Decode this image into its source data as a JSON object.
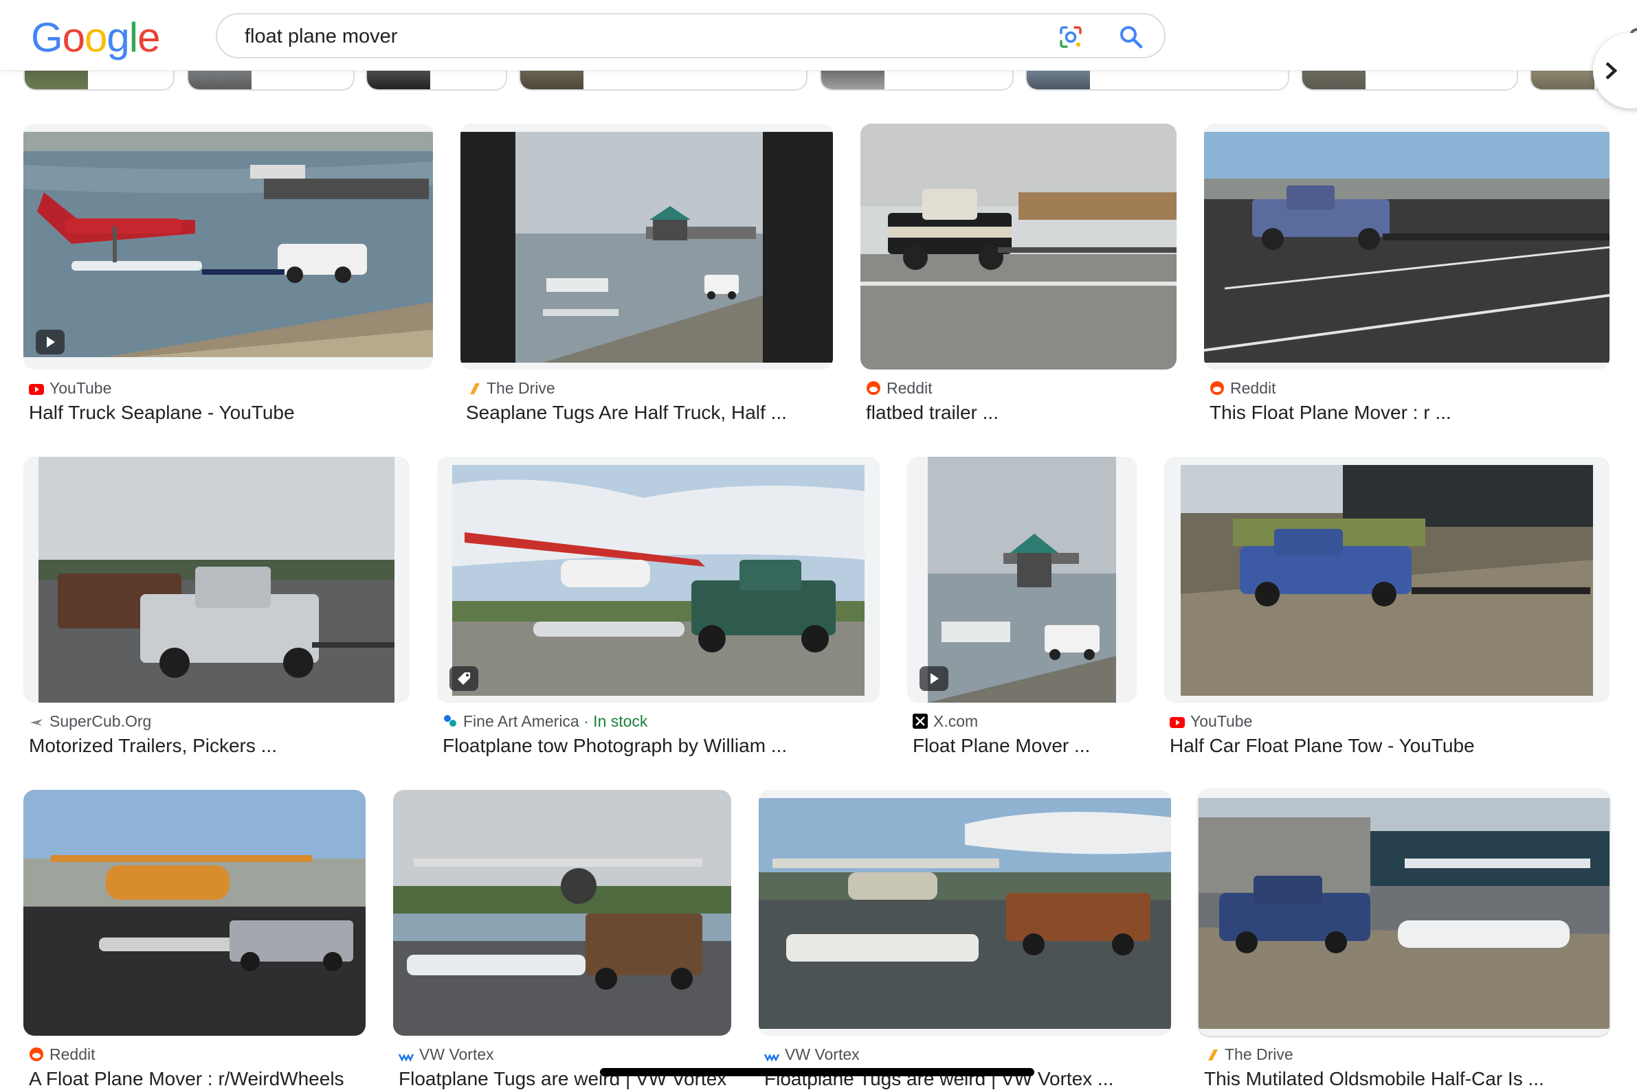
{
  "header": {
    "logo_letters": [
      {
        "ch": "G",
        "color": "#4285F4"
      },
      {
        "ch": "o",
        "color": "#EA4335"
      },
      {
        "ch": "o",
        "color": "#FBBC05"
      },
      {
        "ch": "g",
        "color": "#4285F4"
      },
      {
        "ch": "l",
        "color": "#34A853"
      },
      {
        "ch": "e",
        "color": "#EA4335"
      }
    ],
    "search_value": "float plane mover"
  },
  "icons": {
    "lens": "google-lens-icon",
    "search": "search-icon",
    "next": "chevron-right-icon",
    "play": "play-icon",
    "tag": "price-tag-icon"
  },
  "results": [
    {
      "source": "YouTube",
      "title": "Half Truck Seaplane - YouTube",
      "badge": "play",
      "favicon": "youtube"
    },
    {
      "source": "The Drive",
      "title": "Seaplane Tugs Are Half Truck, Half ...",
      "favicon": "thedrive"
    },
    {
      "source": "Reddit",
      "title": "flatbed trailer ...",
      "favicon": "reddit"
    },
    {
      "source": "Reddit",
      "title": "This Float Plane Mover : r ...",
      "favicon": "reddit"
    },
    {
      "source": "SuperCub.Org",
      "title": "Motorized Trailers, Pickers ...",
      "favicon": "supercub"
    },
    {
      "source": "Fine Art America",
      "stock": " · In stock",
      "title": "Floatplane tow Photograph by William ...",
      "badge": "tag",
      "favicon": "fineart"
    },
    {
      "source": "X.com",
      "title": "Float Plane Mover ...",
      "badge": "play",
      "favicon": "x"
    },
    {
      "source": "YouTube",
      "title": "Half Car Float Plane Tow - YouTube",
      "favicon": "youtube"
    },
    {
      "source": "Reddit",
      "title": "A Float Plane Mover : r/WeirdWheels",
      "favicon": "reddit"
    },
    {
      "source": "VW Vortex",
      "title": "Floatplane Tugs are weird | VW Vortex ...",
      "favicon": "vwvortex"
    },
    {
      "source": "VW Vortex",
      "title": "Floatplane Tugs are weird | VW Vortex ...",
      "favicon": "vwvortex"
    },
    {
      "source": "The Drive",
      "title": "This Mutilated Oldsmobile Half-Car Is ...",
      "favicon": "thedrive"
    }
  ],
  "colors": {
    "accent_blue": "#1a73e8",
    "stock_green": "#188038",
    "youtube_red": "#FF0000",
    "reddit_orange": "#FF4500"
  }
}
